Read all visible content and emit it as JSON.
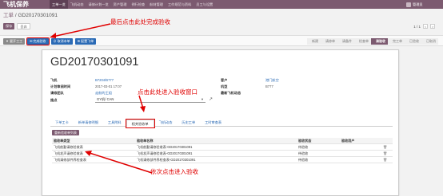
{
  "app": {
    "title": "飞机保养",
    "nav": [
      "工单一览",
      "飞机动态",
      "请修计划一览",
      "资产管理",
      "例行检查",
      "航材管理",
      "工作规范与资料",
      "员工与设置"
    ],
    "user": "管理员"
  },
  "breadcrumb": {
    "parent": "工单",
    "separator": "/",
    "current": "GD20170301091"
  },
  "buttons": {
    "edit": "保存",
    "discard": "丢弃",
    "pager_text": "1 / 1",
    "prev": "<",
    "next": ">"
  },
  "actions": [
    {
      "label": "▼ 要开工工",
      "style": "grey"
    },
    {
      "label": "✉ 完成验收",
      "style": "blue",
      "highlight": true
    },
    {
      "label": "⊘ 取消本单",
      "style": "blue"
    },
    {
      "label": "⊞ 配置飞单",
      "style": "blue"
    }
  ],
  "stages": [
    "新建",
    "请修单",
    "请备件",
    "检查单",
    "请验收",
    "完工单",
    "已验收",
    "已取消"
  ],
  "active_stage": "请验收",
  "record": {
    "title": "GD20170301091",
    "fields_left": [
      {
        "label": "飞机",
        "value": "B7204/B777",
        "link": true
      },
      {
        "label": "计划审阅时间",
        "value": "2017-03-01 17:07",
        "link": false
      },
      {
        "label": "请修团队",
        "value": "走航的王组",
        "link": true
      },
      {
        "label": "施点",
        "value": "GY机/ CAN",
        "link": false
      }
    ],
    "fields_right": [
      {
        "label": "客户",
        "value": "港门航空",
        "link": true
      },
      {
        "label": "机型",
        "value": "B777",
        "link": false
      },
      {
        "label": "最新飞机动态",
        "value": "",
        "link": false
      }
    ]
  },
  "tabs": [
    "下单工卡",
    "新单请修明细",
    "工具附料",
    "相关验收单",
    "飞机动态",
    "历史工单",
    "工时审查表"
  ],
  "active_tab": "相关验收单",
  "inner_button": "重新验收单列表",
  "table": {
    "headers": [
      "验收单类型",
      "验收单名称",
      "验收状态",
      "验收用户",
      ""
    ],
    "rows": [
      [
        "飞机航勤请修验收表",
        "飞机航勤请修验收表-GD20170301091",
        "待验收",
        "",
        "🗑"
      ],
      [
        "飞机发声请修验收表",
        "飞机发声请修验收表-GD20170301091",
        "待验收",
        "",
        "🗑"
      ],
      [
        "飞机请修部件养检查表",
        "飞机请修部件养检查表-GD20170301091",
        "待验收",
        "",
        "🗑"
      ]
    ]
  },
  "annotations": {
    "top": "最后点击此处完成验收",
    "middle": "点击此处进入验收窗口",
    "bottom": "依次点击进入验收"
  },
  "colors": {
    "brand": "#7c5a70",
    "accent": "#2a6ab5",
    "annotation": "#e00000"
  }
}
